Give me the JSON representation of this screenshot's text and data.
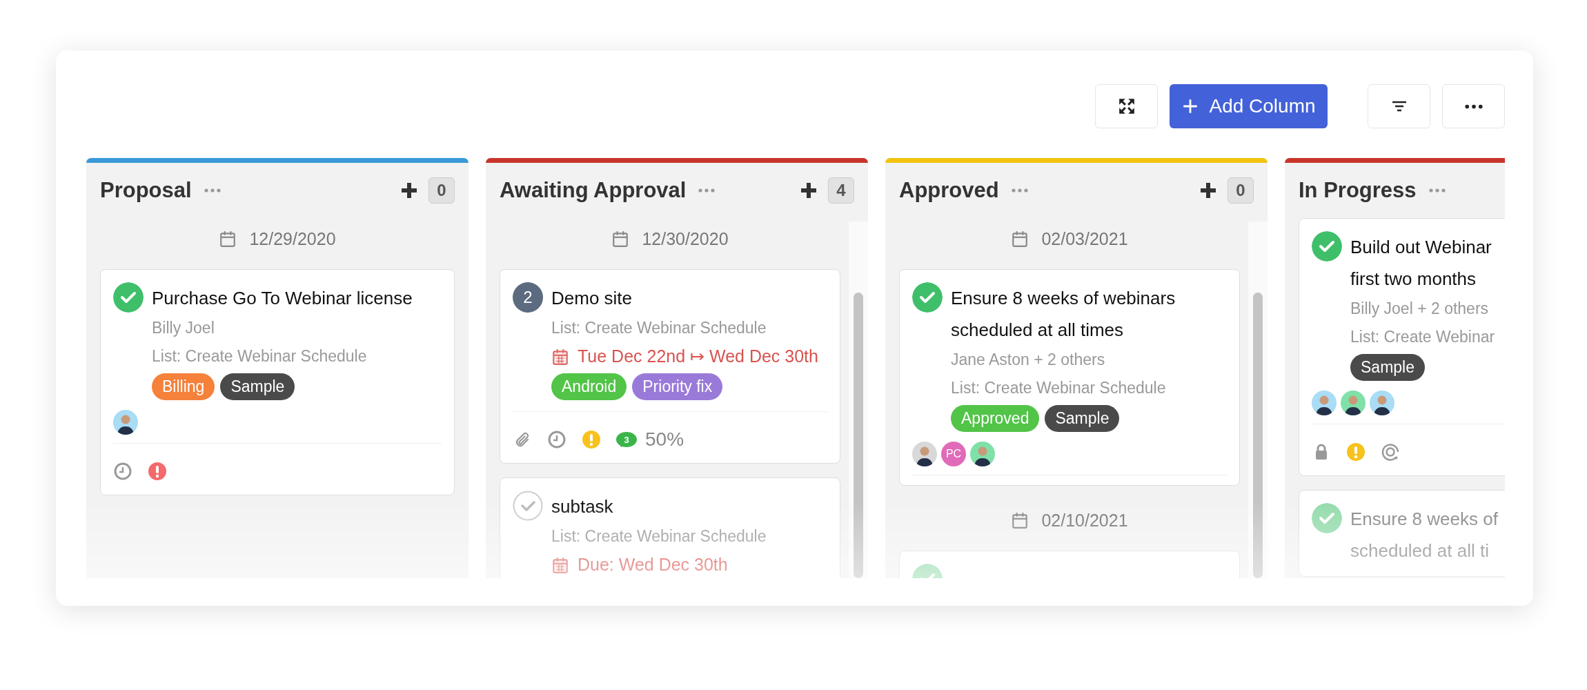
{
  "toolbar": {
    "add_column": "Add Column"
  },
  "columns": [
    {
      "title": "Proposal",
      "color": "#3a99d8",
      "count": "0",
      "date": "12/29/2020",
      "scroll": false,
      "cards": [
        {
          "kind": "done",
          "title_lines": [
            "Purchase Go To Webinar license"
          ],
          "meta": [
            "Billy Joel",
            "List: Create Webinar Schedule"
          ],
          "tags": [
            {
              "label": "Billing",
              "color": "#f5813a"
            },
            {
              "label": "Sample",
              "color": "#4a4a4a"
            }
          ],
          "avatars": [
            {
              "kind": "photo",
              "color": "#a9dcf5"
            }
          ],
          "footer": [
            {
              "kind": "clock"
            },
            {
              "kind": "alert",
              "color": "#f46a6a"
            }
          ],
          "faded": false
        }
      ]
    },
    {
      "title": "Awaiting Approval",
      "color": "#c8352c",
      "count": "4",
      "date": "12/30/2020",
      "scroll": true,
      "cards": [
        {
          "kind": "number",
          "number": "2",
          "title_lines": [
            "Demo site"
          ],
          "meta": [
            "List: Create Webinar Schedule"
          ],
          "due": "Tue Dec 22nd ↦ Wed Dec 30th",
          "tags": [
            {
              "label": "Android",
              "color": "#52c448"
            },
            {
              "label": "Priority fix",
              "color": "#9a7ad9"
            }
          ],
          "footer": [
            {
              "kind": "attachment"
            },
            {
              "kind": "clock"
            },
            {
              "kind": "alert",
              "color": "#f8c21c"
            },
            {
              "kind": "comments",
              "text": "3"
            },
            {
              "kind": "progress",
              "text": "50%"
            }
          ],
          "faded": false
        },
        {
          "kind": "open",
          "title_lines": [
            "subtask"
          ],
          "meta": [
            "List: Create Webinar Schedule"
          ],
          "due": "Due: Wed Dec 30th",
          "faded": false
        }
      ]
    },
    {
      "title": "Approved",
      "color": "#f2c30f",
      "count": "0",
      "date": "02/03/2021",
      "scroll": true,
      "cards": [
        {
          "kind": "done",
          "title_lines": [
            "Ensure 8 weeks of webinars",
            "scheduled at all times"
          ],
          "meta": [
            "Jane Aston + 2 others",
            "List: Create Webinar Schedule"
          ],
          "tags": [
            {
              "label": "Approved",
              "color": "#52c448"
            },
            {
              "label": "Sample",
              "color": "#4a4a4a"
            }
          ],
          "avatars": [
            {
              "kind": "photo",
              "color": "#d8d8d8"
            },
            {
              "kind": "initials",
              "text": "PC",
              "color": "#e06bb8"
            },
            {
              "kind": "photo",
              "color": "#7fe0a8"
            }
          ],
          "faded": false
        }
      ],
      "date2": "02/10/2021",
      "cards2": [
        {
          "kind": "done",
          "faded": true
        }
      ]
    },
    {
      "title": "In Progress",
      "color": "#c8352c",
      "scroll": false,
      "cards": [
        {
          "kind": "done",
          "title_lines": [
            "Build out Webinar",
            "first two months"
          ],
          "meta": [
            "Billy Joel + 2 others",
            "List: Create Webinar"
          ],
          "tags": [
            {
              "label": "Sample",
              "color": "#4a4a4a"
            }
          ],
          "avatars": [
            {
              "kind": "photo",
              "color": "#a9dcf5"
            },
            {
              "kind": "photo",
              "color": "#7fe0a8"
            },
            {
              "kind": "photo",
              "color": "#a9dcf5"
            }
          ],
          "footer": [
            {
              "kind": "lock"
            },
            {
              "kind": "alert",
              "color": "#f8c21c"
            },
            {
              "kind": "target"
            }
          ],
          "faded": false
        },
        {
          "kind": "done",
          "title_lines": [
            "Ensure 8 weeks of",
            "scheduled at all ti"
          ],
          "faded": true
        }
      ]
    }
  ]
}
